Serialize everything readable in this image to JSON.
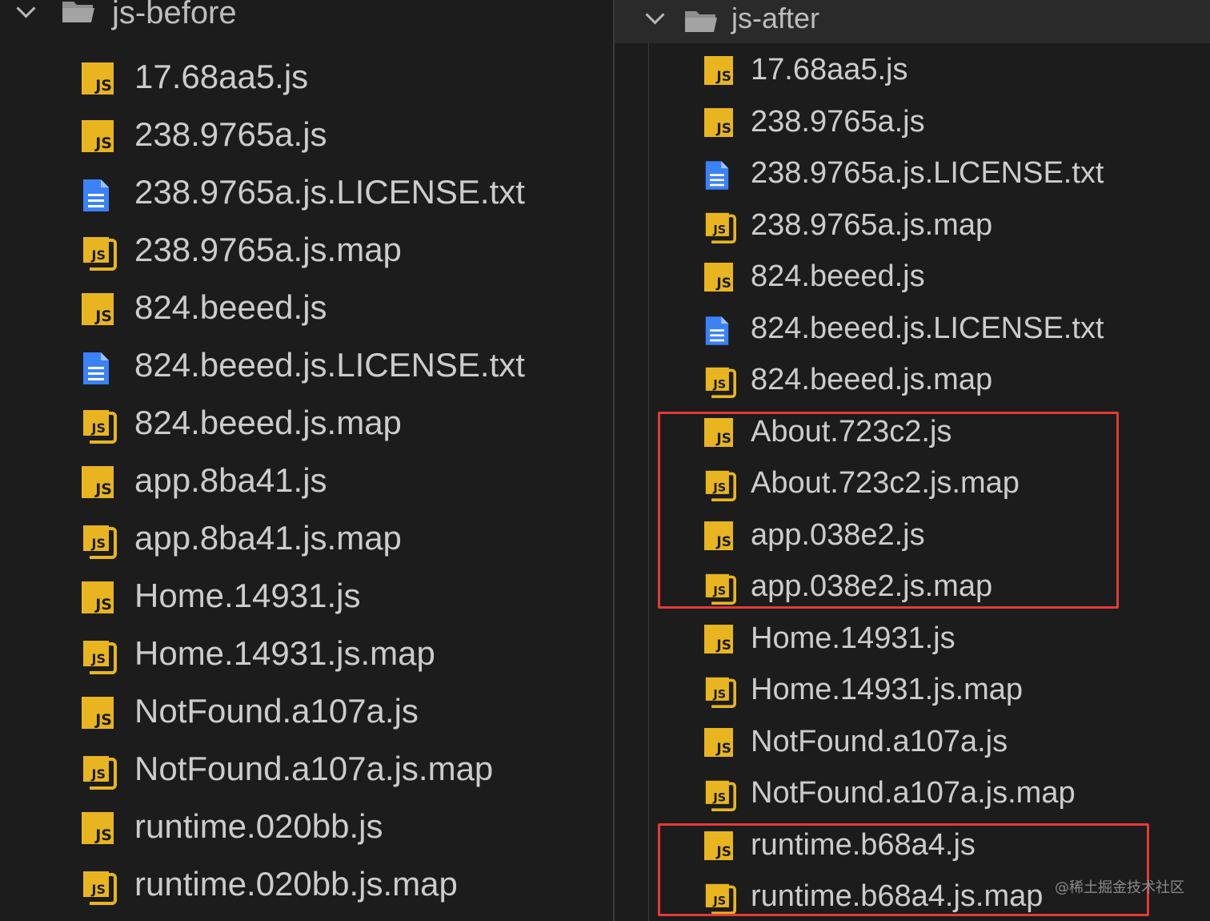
{
  "left": {
    "folder": "js-before",
    "files": [
      {
        "name": "17.68aa5.js",
        "type": "js"
      },
      {
        "name": "238.9765a.js",
        "type": "js"
      },
      {
        "name": "238.9765a.js.LICENSE.txt",
        "type": "txt"
      },
      {
        "name": "238.9765a.js.map",
        "type": "map"
      },
      {
        "name": "824.beeed.js",
        "type": "js"
      },
      {
        "name": "824.beeed.js.LICENSE.txt",
        "type": "txt"
      },
      {
        "name": "824.beeed.js.map",
        "type": "map"
      },
      {
        "name": "app.8ba41.js",
        "type": "js"
      },
      {
        "name": "app.8ba41.js.map",
        "type": "map"
      },
      {
        "name": "Home.14931.js",
        "type": "js"
      },
      {
        "name": "Home.14931.js.map",
        "type": "map"
      },
      {
        "name": "NotFound.a107a.js",
        "type": "js"
      },
      {
        "name": "NotFound.a107a.js.map",
        "type": "map"
      },
      {
        "name": "runtime.020bb.js",
        "type": "js"
      },
      {
        "name": "runtime.020bb.js.map",
        "type": "map"
      }
    ]
  },
  "right": {
    "folder": "js-after",
    "files": [
      {
        "name": "17.68aa5.js",
        "type": "js"
      },
      {
        "name": "238.9765a.js",
        "type": "js"
      },
      {
        "name": "238.9765a.js.LICENSE.txt",
        "type": "txt"
      },
      {
        "name": "238.9765a.js.map",
        "type": "map"
      },
      {
        "name": "824.beeed.js",
        "type": "js"
      },
      {
        "name": "824.beeed.js.LICENSE.txt",
        "type": "txt"
      },
      {
        "name": "824.beeed.js.map",
        "type": "map"
      },
      {
        "name": "About.723c2.js",
        "type": "js"
      },
      {
        "name": "About.723c2.js.map",
        "type": "map"
      },
      {
        "name": "app.038e2.js",
        "type": "js"
      },
      {
        "name": "app.038e2.js.map",
        "type": "map"
      },
      {
        "name": "Home.14931.js",
        "type": "js"
      },
      {
        "name": "Home.14931.js.map",
        "type": "map"
      },
      {
        "name": "NotFound.a107a.js",
        "type": "js"
      },
      {
        "name": "NotFound.a107a.js.map",
        "type": "map"
      },
      {
        "name": "runtime.b68a4.js",
        "type": "js"
      },
      {
        "name": "runtime.b68a4.js.map",
        "type": "map"
      }
    ]
  },
  "icons": {
    "folder": "folder-open-icon",
    "chevron": "chevron-down-icon",
    "js": "js-file-icon",
    "map": "js-map-file-icon",
    "txt": "text-file-icon"
  },
  "colors": {
    "js_icon": "#e8b520",
    "txt_icon": "#3b82f6",
    "highlight": "#e53935"
  },
  "js_badge": "JS",
  "watermark": "@稀土掘金技术社区"
}
